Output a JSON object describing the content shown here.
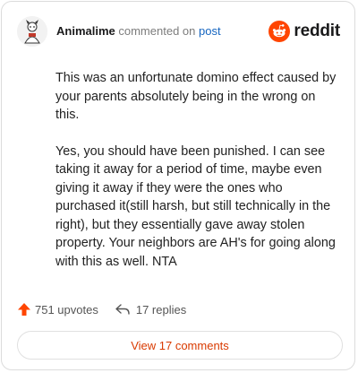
{
  "comment": {
    "username": "Animalime",
    "action_text": "commented on",
    "post_link": "post",
    "paragraphs": [
      "This was an unfortunate domino effect caused by your parents absolutely being in the wrong on this.",
      "Yes, you should have been punished. I can see taking it away for a period of time, maybe even giving it away if they were the ones who purchased it(still harsh, but still technically in the right), but they essentially gave away stolen property. Your neighbors are AH's for going along with this as well. NTA"
    ]
  },
  "logo": {
    "text": "reddit",
    "icon": "reddit-snoo-icon",
    "color": "#ff4500"
  },
  "stats": {
    "upvotes_label": "751 upvotes",
    "replies_label": "17 replies",
    "upvote_icon": "upvote-arrow-icon",
    "reply_icon": "reply-arrow-icon",
    "upvote_color": "#ff4500"
  },
  "view_comments": {
    "label": "View 17 comments",
    "color": "#d93a00"
  }
}
